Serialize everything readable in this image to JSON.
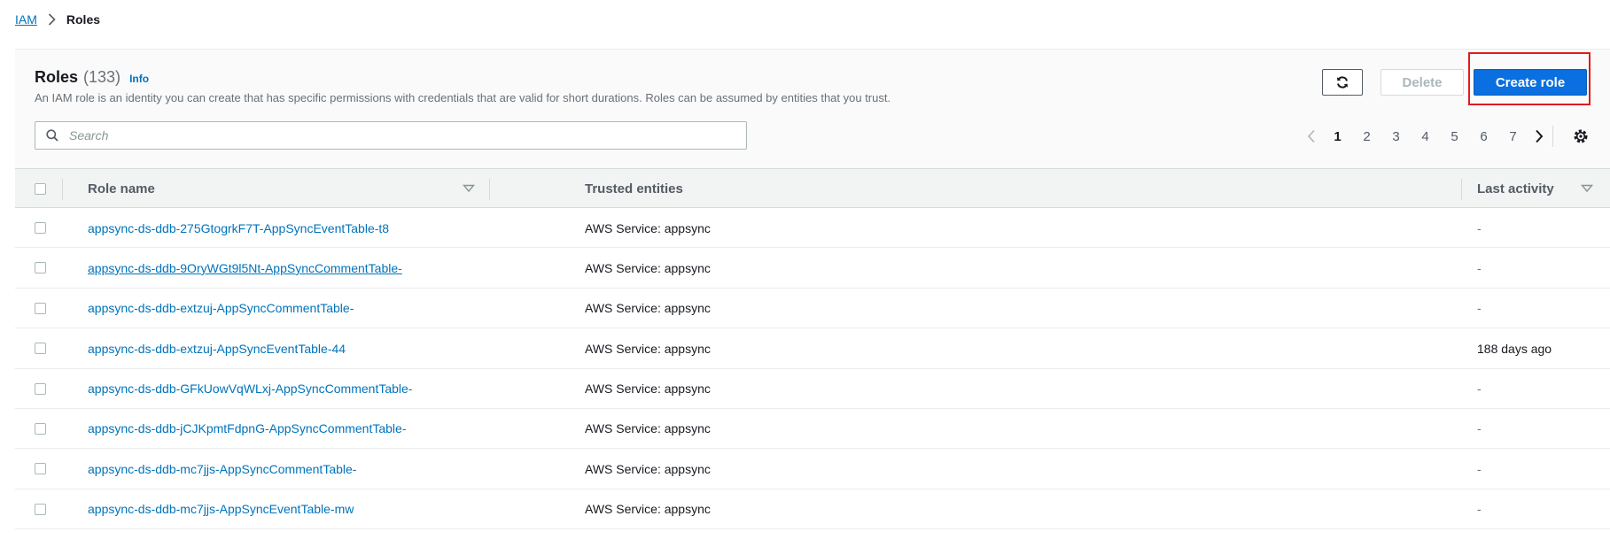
{
  "breadcrumb": {
    "parent": "IAM",
    "current": "Roles"
  },
  "header": {
    "title": "Roles",
    "count": "(133)",
    "info": "Info",
    "description": "An IAM role is an identity you can create that has specific permissions with credentials that are valid for short durations. Roles can be assumed by entities that you trust."
  },
  "toolbar": {
    "delete_label": "Delete",
    "create_label": "Create role",
    "refresh_icon": "refresh-icon"
  },
  "search": {
    "placeholder": "Search",
    "value": ""
  },
  "pagination": {
    "pages": [
      "1",
      "2",
      "3",
      "4",
      "5",
      "6",
      "7"
    ],
    "current": "1"
  },
  "table": {
    "columns": {
      "name": "Role name",
      "trusted": "Trusted entities",
      "activity": "Last activity"
    },
    "rows": [
      {
        "name": "appsync-ds-ddb-275GtogrkF7T-AppSyncEventTable-t8",
        "trusted": "AWS Service: appsync",
        "activity": "-"
      },
      {
        "name": "appsync-ds-ddb-9OryWGt9l5Nt-AppSyncCommentTable-",
        "trusted": "AWS Service: appsync",
        "activity": "-"
      },
      {
        "name": "appsync-ds-ddb-extzuj-AppSyncCommentTable-",
        "trusted": "AWS Service: appsync",
        "activity": "-"
      },
      {
        "name": "appsync-ds-ddb-extzuj-AppSyncEventTable-44",
        "trusted": "AWS Service: appsync",
        "activity": "188 days ago"
      },
      {
        "name": "appsync-ds-ddb-GFkUowVqWLxj-AppSyncCommentTable-",
        "trusted": "AWS Service: appsync",
        "activity": "-"
      },
      {
        "name": "appsync-ds-ddb-jCJKpmtFdpnG-AppSyncCommentTable-",
        "trusted": "AWS Service: appsync",
        "activity": "-"
      },
      {
        "name": "appsync-ds-ddb-mc7jjs-AppSyncCommentTable-",
        "trusted": "AWS Service: appsync",
        "activity": "-"
      },
      {
        "name": "appsync-ds-ddb-mc7jjs-AppSyncEventTable-mw",
        "trusted": "AWS Service: appsync",
        "activity": "-"
      }
    ]
  },
  "colors": {
    "link": "#0073bb",
    "primary_button": "#0a6fe0",
    "highlight": "#e01b1b"
  }
}
